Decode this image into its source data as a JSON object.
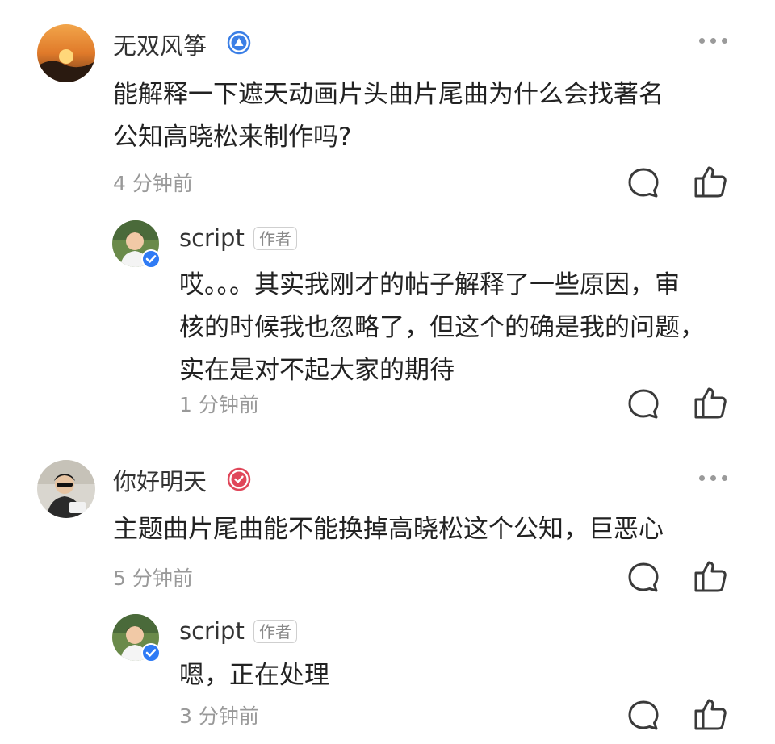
{
  "comments": [
    {
      "author": "无双风筝",
      "text_lines": [
        "能解释一下遮天动画片头曲片尾曲为什么会找著名",
        "公知高晓松来制作吗?"
      ],
      "time": "4 分钟前",
      "reply": {
        "author": "script",
        "author_tag": "作者",
        "text_lines": [
          "哎。。。其实我刚才的帖子解释了一些原因，审",
          "核的时候我也忽略了，但这个的确是我的问题，",
          "实在是对不起大家的期待"
        ],
        "time": "1 分钟前"
      }
    },
    {
      "author": "你好明天",
      "text_lines": [
        "主题曲片尾曲能不能换掉高晓松这个公知，巨恶心"
      ],
      "time": "5 分钟前",
      "reply": {
        "author": "script",
        "author_tag": "作者",
        "text_lines": [
          "嗯，正在处理"
        ],
        "time": "3 分钟前"
      }
    }
  ],
  "icons": {
    "more": "more-horizontal-icon",
    "reply": "comment-bubble-icon",
    "like": "thumbs-up-icon",
    "badge_level": "blue-triangle-badge-icon",
    "badge_check": "red-check-badge-icon",
    "verified": "blue-verified-check-icon"
  },
  "colors": {
    "name": "#333333",
    "body": "#222222",
    "time": "#999999",
    "verified_blue": "#2f7bf5",
    "badge_red": "#e0475a"
  }
}
